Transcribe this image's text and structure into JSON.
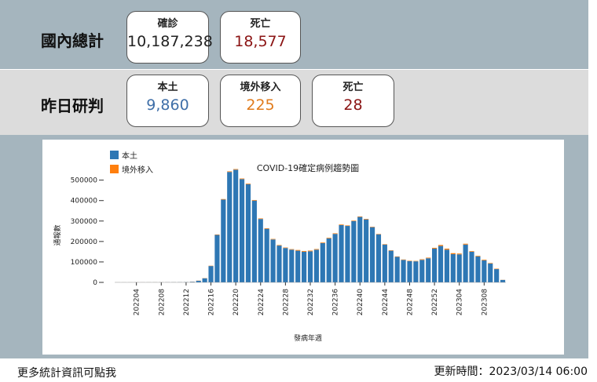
{
  "summary": {
    "total_title": "國內總計",
    "total_cards": [
      {
        "label": "確診",
        "value": "10,187,238",
        "color": "#222222"
      },
      {
        "label": "死亡",
        "value": "18,577",
        "color": "#8b1414"
      }
    ],
    "yesterday_title": "昨日研判",
    "yesterday_cards": [
      {
        "label": "本土",
        "value": "9,860",
        "color": "#3f6fa8"
      },
      {
        "label": "境外移入",
        "value": "225",
        "color": "#e07b1c"
      },
      {
        "label": "死亡",
        "value": "28",
        "color": "#8b1414"
      }
    ]
  },
  "colors": {
    "local": "#2e77b4",
    "imported": "#ff7f0e",
    "band_top": "#a5b5be",
    "band_mid": "#dcdcdc"
  },
  "chart_data": {
    "type": "bar",
    "stacked": true,
    "title": "COVID-19確定病例趨勢圖",
    "xlabel": "發病年週",
    "ylabel": "通報數",
    "ylim": [
      0,
      560000
    ],
    "yticks": [
      "0",
      "100000",
      "200000",
      "300000",
      "400000",
      "500000"
    ],
    "xticks": [
      "202204",
      "202208",
      "202212",
      "202216",
      "202220",
      "202224",
      "202228",
      "202232",
      "202236",
      "202240",
      "202244",
      "202248",
      "202252",
      "202304",
      "202308"
    ],
    "legend": [
      "本土",
      "境外移入"
    ],
    "legend_position": "top-left",
    "categories": [
      "202201",
      "202202",
      "202203",
      "202204",
      "202205",
      "202206",
      "202207",
      "202208",
      "202209",
      "202210",
      "202211",
      "202212",
      "202213",
      "202214",
      "202215",
      "202216",
      "202217",
      "202218",
      "202219",
      "202220",
      "202221",
      "202222",
      "202223",
      "202224",
      "202225",
      "202226",
      "202227",
      "202228",
      "202229",
      "202230",
      "202231",
      "202232",
      "202233",
      "202234",
      "202235",
      "202236",
      "202237",
      "202238",
      "202239",
      "202240",
      "202241",
      "202242",
      "202243",
      "202244",
      "202245",
      "202246",
      "202247",
      "202248",
      "202249",
      "202250",
      "202251",
      "202252",
      "202301",
      "202302",
      "202303",
      "202304",
      "202305",
      "202306",
      "202307",
      "202308",
      "202309",
      "202310",
      "202311"
    ],
    "series": [
      {
        "name": "本土",
        "values": [
          300,
          300,
          300,
          400,
          400,
          500,
          600,
          700,
          800,
          900,
          1000,
          1500,
          3000,
          8000,
          20000,
          80000,
          232000,
          405000,
          540000,
          551000,
          505000,
          480000,
          400000,
          310000,
          262000,
          210000,
          180000,
          168000,
          160000,
          155000,
          150000,
          152000,
          160000,
          192000,
          215000,
          237000,
          280000,
          276000,
          300000,
          320000,
          308000,
          270000,
          235000,
          185000,
          155000,
          125000,
          110000,
          104000,
          103000,
          110000,
          118000,
          165000,
          178000,
          160000,
          138000,
          137000,
          185000,
          150000,
          127000,
          108000,
          92000,
          65000,
          12000
        ]
      },
      {
        "name": "境外移入",
        "values": [
          200,
          200,
          200,
          250,
          250,
          250,
          300,
          300,
          300,
          300,
          300,
          400,
          500,
          800,
          1000,
          1500,
          2000,
          2500,
          3000,
          3000,
          3000,
          3000,
          2800,
          2800,
          2800,
          2500,
          2500,
          2500,
          2500,
          3500,
          3500,
          3500,
          3000,
          3000,
          3000,
          3000,
          3000,
          2500,
          2500,
          2500,
          2500,
          2000,
          2000,
          2000,
          2000,
          2000,
          2000,
          2000,
          2000,
          3000,
          3000,
          4000,
          5000,
          5000,
          5000,
          4000,
          4000,
          3000,
          3000,
          3000,
          2500,
          2000,
          500
        ]
      }
    ]
  },
  "footer": {
    "more_link": "更多統計資訊可點我",
    "updated": "更新時間：2023/03/14 06:00"
  }
}
